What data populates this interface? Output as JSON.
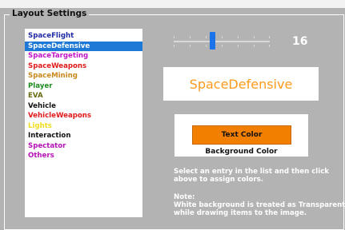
{
  "group_title": "Layout Settings",
  "list_items": [
    {
      "label": "SpaceFlight",
      "color": "#1f2aa6",
      "selected": false
    },
    {
      "label": "SpaceDefensive",
      "color": "#ffffff",
      "selected": true
    },
    {
      "label": "SpaceTargeting",
      "color": "#c214c8",
      "selected": false
    },
    {
      "label": "SpaceWeapons",
      "color": "#e01a1a",
      "selected": false
    },
    {
      "label": "SpaceMining",
      "color": "#c8871a",
      "selected": false
    },
    {
      "label": "Player",
      "color": "#1f8a1f",
      "selected": false
    },
    {
      "label": "EVA",
      "color": "#6a6a13",
      "selected": false
    },
    {
      "label": "Vehicle",
      "color": "#111111",
      "selected": false
    },
    {
      "label": "VehicleWeapons",
      "color": "#e01a1a",
      "selected": false
    },
    {
      "label": "Lights",
      "color": "#f0dc1e",
      "selected": false
    },
    {
      "label": "Interaction",
      "color": "#111111",
      "selected": false
    },
    {
      "label": "Spectator",
      "color": "#b512b5",
      "selected": false
    },
    {
      "label": "Others",
      "color": "#b512b5",
      "selected": false
    }
  ],
  "slider": {
    "value": "16",
    "fraction": 0.4
  },
  "preview_text": "SpaceDefensive",
  "text_color_label": "Text Color",
  "background_color_label": "Background Color",
  "instructions": "Select an entry in the list and then click above to assign colors.",
  "note": {
    "title": "Note:",
    "line1": "White background is treated as Transparent",
    "line2": "while drawing items to the image."
  },
  "colors": {
    "text_color": "#f27f00",
    "preview_text_color": "#ff9a1c",
    "selection": "#1e78d6"
  }
}
